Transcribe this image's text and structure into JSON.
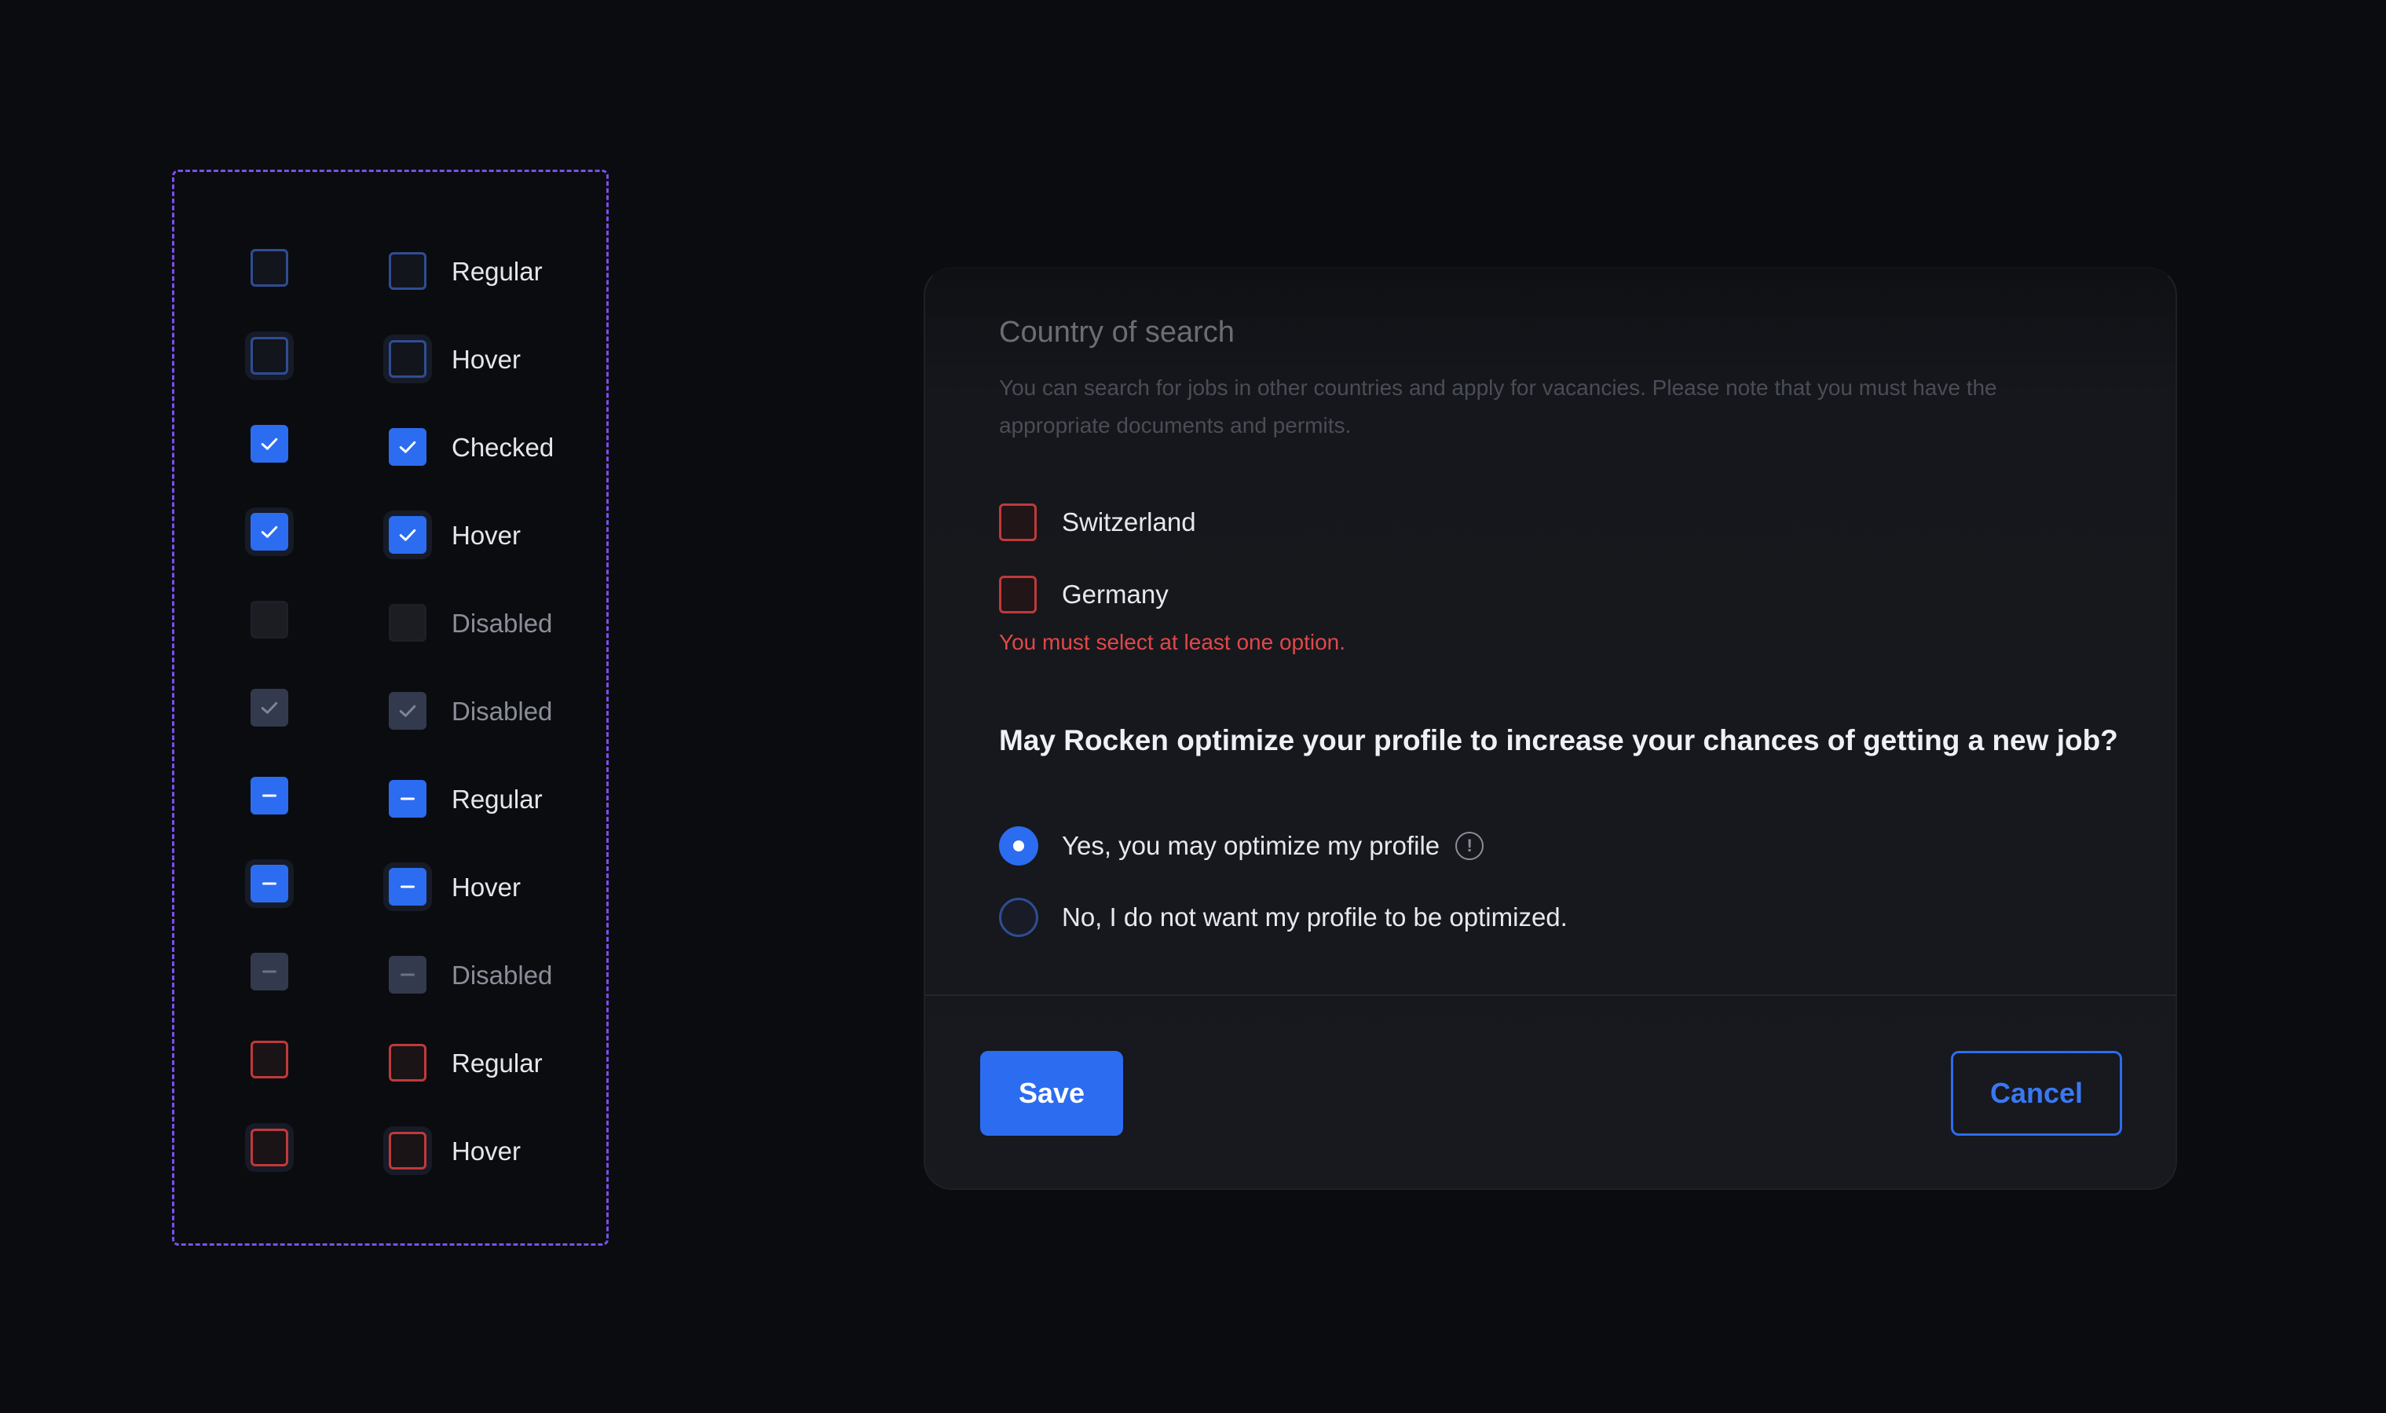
{
  "states": [
    {
      "label": "Regular",
      "type": "empty",
      "hover": false,
      "muted": false
    },
    {
      "label": "Hover",
      "type": "empty",
      "hover": true,
      "muted": false
    },
    {
      "label": "Checked",
      "type": "check",
      "hover": false,
      "muted": false
    },
    {
      "label": "Hover",
      "type": "check",
      "hover": true,
      "muted": false
    },
    {
      "label": "Disabled",
      "type": "disabled",
      "hover": false,
      "muted": true
    },
    {
      "label": "Disabled",
      "type": "disabled-check",
      "hover": false,
      "muted": true
    },
    {
      "label": "Regular",
      "type": "indeterminate",
      "hover": false,
      "muted": false
    },
    {
      "label": "Hover",
      "type": "indeterminate",
      "hover": true,
      "muted": false
    },
    {
      "label": "Disabled",
      "type": "disabled-indeterminate",
      "hover": false,
      "muted": true
    },
    {
      "label": "Regular",
      "type": "error",
      "hover": false,
      "muted": false
    },
    {
      "label": "Hover",
      "type": "error",
      "hover": true,
      "muted": false
    }
  ],
  "form": {
    "section_title": "Country of search",
    "section_description": "You can search for jobs in other countries and apply for vacancies. Please note that you must have the appropriate documents and permits.",
    "options": [
      {
        "label": "Switzerland",
        "checked": false,
        "error": true
      },
      {
        "label": "Germany",
        "checked": false,
        "error": true
      }
    ],
    "error_message": "You must select at least one option.",
    "question": "May Rocken optimize your profile to increase your chances of getting a new job?",
    "radios": [
      {
        "label": "Yes, you may optimize my profile",
        "selected": true,
        "info_icon": "info-icon"
      },
      {
        "label": "No, I do not want my profile to be optimized.",
        "selected": false
      }
    ],
    "info_glyph": "!",
    "save_label": "Save",
    "cancel_label": "Cancel"
  },
  "colors": {
    "accent": "#2c6cf0",
    "error": "#e0484a",
    "panel_outline": "#7b4ff0",
    "background": "#0b0c0f"
  }
}
